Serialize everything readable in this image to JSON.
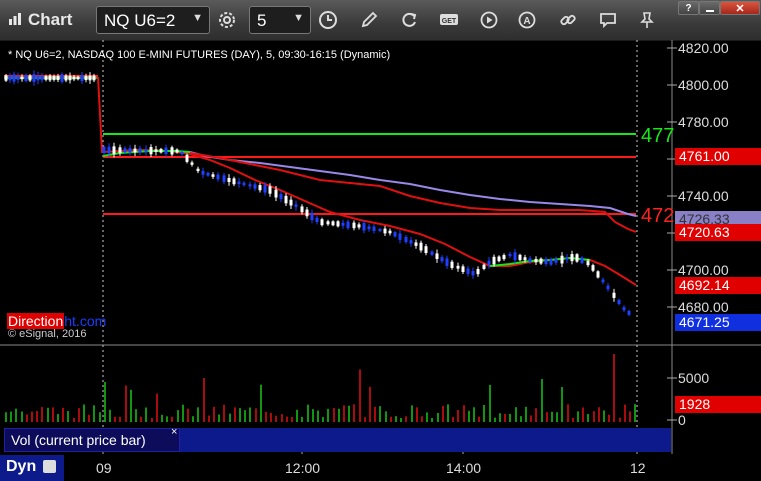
{
  "window": {
    "title": "Chart",
    "symbol": "NQ U6=2",
    "interval": "5"
  },
  "chart": {
    "header": "* NQ U6=2, NASDAQ 100 E-MINI FUTURES (DAY), 5, 09:30-16:15 (Dynamic)",
    "copyright": "© eSignal, 2016",
    "brand_red": "Direction",
    "brand_blue": "ht.com",
    "price_axis": [
      "4820.00",
      "4800.00",
      "4780.00",
      "4760.00",
      "4740.00",
      "4720.00",
      "4700.00",
      "4680.00"
    ],
    "line_labels": {
      "green": "477",
      "red": "472"
    },
    "tags": {
      "level_4761": "4761.00",
      "vwap": "4726.33",
      "level_4720": "4720.63",
      "ma": "4692.14",
      "last": "4671.25"
    },
    "colors": {
      "up_candle": "#ffffff",
      "down_candle": "#2040ff",
      "resistance": "#ff1a1a",
      "support": "#19e619",
      "vwap": "#9a88e8",
      "ma": "#e01010"
    }
  },
  "volume": {
    "label": "Vol (current price bar)",
    "close": "×",
    "axis": [
      "5000",
      "0"
    ],
    "current": "1928"
  },
  "footer": {
    "mode": "Dyn",
    "time_axis": [
      "09",
      "12:00",
      "14:00",
      "12"
    ]
  }
}
